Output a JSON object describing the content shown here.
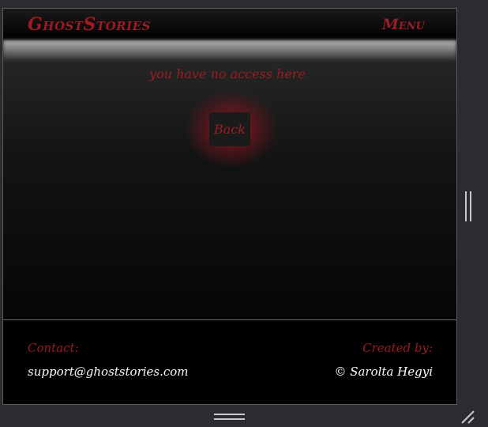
{
  "navbar": {
    "brand": "GhostStories",
    "menu_label": "Menu"
  },
  "main": {
    "message": "you have no access here",
    "back_label": "Back"
  },
  "footer": {
    "contact_label": "Contact:",
    "contact_email": "support@ghoststories.com",
    "created_label": "Created by:",
    "creator": "© Sarolta Hegyi"
  },
  "colors": {
    "accent": "#9b1c24",
    "background": "#000000",
    "chrome": "#2b2c2f"
  },
  "icons": [
    "vertical-drag-handle-icon",
    "horizontal-drag-handle-icon",
    "resize-grip-icon"
  ]
}
